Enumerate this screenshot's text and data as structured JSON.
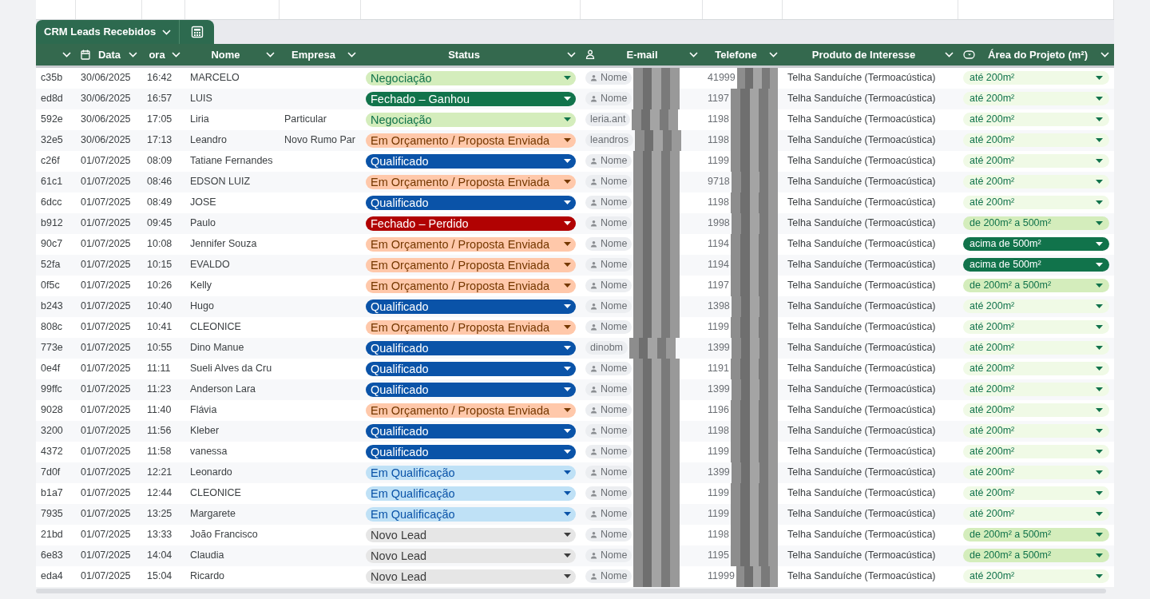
{
  "table_tab": {
    "label": "CRM Leads Recebidos"
  },
  "columns": [
    {},
    {
      "label": "Data"
    },
    {
      "label": "ora"
    },
    {
      "label": "Nome"
    },
    {
      "label": "Empresa"
    },
    {
      "label": "Status"
    },
    {
      "label": "E-mail"
    },
    {
      "label": "Telefone"
    },
    {
      "label": "Produto de Interesse"
    },
    {
      "label": "Área do Projeto (m²)"
    }
  ],
  "rows": [
    {
      "id": "c35b",
      "date": "30/06/2025",
      "time": "16:42",
      "name": "MARCELO",
      "company": "",
      "status": {
        "label": "Negociação",
        "kind": "negotiation"
      },
      "email": {
        "text": "Nome",
        "kind": "person"
      },
      "phone": "41999",
      "product": "Telha Sanduíche (Termoacústica)",
      "area": {
        "label": "até 200m²",
        "kind": "small"
      }
    },
    {
      "id": "ed8d",
      "date": "30/06/2025",
      "time": "16:57",
      "name": "LUIS",
      "company": "",
      "status": {
        "label": "Fechado – Ganhou",
        "kind": "won"
      },
      "email": {
        "text": "Nome",
        "kind": "person"
      },
      "phone": "1197",
      "product": "Telha Sanduíche (Termoacústica)",
      "area": {
        "label": "até 200m²",
        "kind": "small"
      }
    },
    {
      "id": "592e",
      "date": "30/06/2025",
      "time": "17:05",
      "name": "Liria",
      "company": "Particular",
      "status": {
        "label": "Negociação",
        "kind": "negotiation"
      },
      "email": {
        "text": "leria.ant",
        "kind": "address"
      },
      "phone": "1198",
      "product": "Telha Sanduíche (Termoacústica)",
      "area": {
        "label": "até 200m²",
        "kind": "small"
      }
    },
    {
      "id": "32e5",
      "date": "30/06/2025",
      "time": "17:13",
      "name": "Leandro",
      "company": "Novo Rumo Par",
      "status": {
        "label": "Em Orçamento / Proposta Enviada",
        "kind": "proposal"
      },
      "email": {
        "text": "leandros",
        "kind": "address"
      },
      "phone": "1198",
      "product": "Telha Sanduíche (Termoacústica)",
      "area": {
        "label": "até 200m²",
        "kind": "small"
      }
    },
    {
      "id": "c26f",
      "date": "01/07/2025",
      "time": "08:09",
      "name": "Tatiane Fernandes",
      "company": "",
      "status": {
        "label": "Qualificado",
        "kind": "qualified"
      },
      "email": {
        "text": "Nome",
        "kind": "person"
      },
      "phone": "1199",
      "product": "Telha Sanduíche (Termoacústica)",
      "area": {
        "label": "até 200m²",
        "kind": "small"
      }
    },
    {
      "id": "61c1",
      "date": "01/07/2025",
      "time": "08:46",
      "name": "EDSON LUIZ",
      "company": "",
      "status": {
        "label": "Em Orçamento / Proposta Enviada",
        "kind": "proposal"
      },
      "email": {
        "text": "Nome",
        "kind": "person"
      },
      "phone": "9718",
      "product": "Telha Sanduíche (Termoacústica)",
      "area": {
        "label": "até 200m²",
        "kind": "small"
      }
    },
    {
      "id": "6dcc",
      "date": "01/07/2025",
      "time": "08:49",
      "name": "JOSE",
      "company": "",
      "status": {
        "label": "Qualificado",
        "kind": "qualified"
      },
      "email": {
        "text": "Nome",
        "kind": "person"
      },
      "phone": "1198",
      "product": "Telha Sanduíche (Termoacústica)",
      "area": {
        "label": "até 200m²",
        "kind": "small"
      }
    },
    {
      "id": "b912",
      "date": "01/07/2025",
      "time": "09:45",
      "name": "Paulo",
      "company": "",
      "status": {
        "label": "Fechado – Perdido",
        "kind": "lost"
      },
      "email": {
        "text": "Nome",
        "kind": "person"
      },
      "phone": "1998",
      "product": "Telha Sanduíche (Termoacústica)",
      "area": {
        "label": "de 200m² a 500m²",
        "kind": "medium"
      }
    },
    {
      "id": "90c7",
      "date": "01/07/2025",
      "time": "10:08",
      "name": "Jennifer Souza",
      "company": "",
      "status": {
        "label": "Em Orçamento / Proposta Enviada",
        "kind": "proposal"
      },
      "email": {
        "text": "Nome",
        "kind": "person"
      },
      "phone": "1194",
      "product": "Telha Sanduíche (Termoacústica)",
      "area": {
        "label": "acima de 500m²",
        "kind": "large"
      }
    },
    {
      "id": "52fa",
      "date": "01/07/2025",
      "time": "10:15",
      "name": "EVALDO",
      "company": "",
      "status": {
        "label": "Em Orçamento / Proposta Enviada",
        "kind": "proposal"
      },
      "email": {
        "text": "Nome",
        "kind": "person"
      },
      "phone": "1194",
      "product": "Telha Sanduíche (Termoacústica)",
      "area": {
        "label": "acima de 500m²",
        "kind": "large"
      }
    },
    {
      "id": "0f5c",
      "date": "01/07/2025",
      "time": "10:26",
      "name": "Kelly",
      "company": "",
      "status": {
        "label": "Em Orçamento / Proposta Enviada",
        "kind": "proposal"
      },
      "email": {
        "text": "Nome",
        "kind": "person"
      },
      "phone": "1197",
      "product": "Telha Sanduíche (Termoacústica)",
      "area": {
        "label": "de 200m² a 500m²",
        "kind": "medium"
      }
    },
    {
      "id": "b243",
      "date": "01/07/2025",
      "time": "10:40",
      "name": "Hugo",
      "company": "",
      "status": {
        "label": "Qualificado",
        "kind": "qualified"
      },
      "email": {
        "text": "Nome",
        "kind": "person"
      },
      "phone": "1398",
      "product": "Telha Sanduíche (Termoacústica)",
      "area": {
        "label": "até 200m²",
        "kind": "small"
      }
    },
    {
      "id": "808c",
      "date": "01/07/2025",
      "time": "10:41",
      "name": "CLEONICE",
      "company": "",
      "status": {
        "label": "Em Orçamento / Proposta Enviada",
        "kind": "proposal"
      },
      "email": {
        "text": "Nome",
        "kind": "person"
      },
      "phone": "1199",
      "product": "Telha Sanduíche (Termoacústica)",
      "area": {
        "label": "até 200m²",
        "kind": "small"
      }
    },
    {
      "id": "773e",
      "date": "01/07/2025",
      "time": "10:55",
      "name": "Dino Manue",
      "company": "",
      "status": {
        "label": "Qualificado",
        "kind": "qualified"
      },
      "email": {
        "text": "dinobm",
        "kind": "address"
      },
      "phone": "1399",
      "product": "Telha Sanduíche (Termoacústica)",
      "area": {
        "label": "até 200m²",
        "kind": "small"
      }
    },
    {
      "id": "0e4f",
      "date": "01/07/2025",
      "time": "11:11",
      "name": "Sueli Alves da Cru",
      "company": "",
      "status": {
        "label": "Qualificado",
        "kind": "qualified"
      },
      "email": {
        "text": "Nome",
        "kind": "person"
      },
      "phone": "1191",
      "product": "Telha Sanduíche (Termoacústica)",
      "area": {
        "label": "até 200m²",
        "kind": "small"
      }
    },
    {
      "id": "99ffc",
      "date": "01/07/2025",
      "time": "11:23",
      "name": "Anderson Lara",
      "company": "",
      "status": {
        "label": "Qualificado",
        "kind": "qualified"
      },
      "email": {
        "text": "Nome",
        "kind": "person"
      },
      "phone": "1399",
      "product": "Telha Sanduíche (Termoacústica)",
      "area": {
        "label": "até 200m²",
        "kind": "small"
      }
    },
    {
      "id": "9028",
      "date": "01/07/2025",
      "time": "11:40",
      "name": "Flávia",
      "company": "",
      "status": {
        "label": "Em Orçamento / Proposta Enviada",
        "kind": "proposal"
      },
      "email": {
        "text": "Nome",
        "kind": "person"
      },
      "phone": "1196",
      "product": "Telha Sanduíche (Termoacústica)",
      "area": {
        "label": "até 200m²",
        "kind": "small"
      }
    },
    {
      "id": "3200",
      "date": "01/07/2025",
      "time": "11:56",
      "name": "Kleber",
      "company": "",
      "status": {
        "label": "Qualificado",
        "kind": "qualified"
      },
      "email": {
        "text": "Nome",
        "kind": "person"
      },
      "phone": "1198",
      "product": "Telha Sanduíche (Termoacústica)",
      "area": {
        "label": "até 200m²",
        "kind": "small"
      }
    },
    {
      "id": "4372",
      "date": "01/07/2025",
      "time": "11:58",
      "name": "vanessa",
      "company": "",
      "status": {
        "label": "Qualificado",
        "kind": "qualified"
      },
      "email": {
        "text": "Nome",
        "kind": "person"
      },
      "phone": "1199",
      "product": "Telha Sanduíche (Termoacústica)",
      "area": {
        "label": "até 200m²",
        "kind": "small"
      }
    },
    {
      "id": "7d0f",
      "date": "01/07/2025",
      "time": "12:21",
      "name": "Leonardo",
      "company": "",
      "status": {
        "label": "Em Qualificação",
        "kind": "qualifying"
      },
      "email": {
        "text": "Nome",
        "kind": "person"
      },
      "phone": "1399",
      "product": "Telha Sanduíche (Termoacústica)",
      "area": {
        "label": "até 200m²",
        "kind": "small"
      }
    },
    {
      "id": "b1a7",
      "date": "01/07/2025",
      "time": "12:44",
      "name": "CLEONICE",
      "company": "",
      "status": {
        "label": "Em Qualificação",
        "kind": "qualifying"
      },
      "email": {
        "text": "Nome",
        "kind": "person"
      },
      "phone": "1199",
      "product": "Telha Sanduíche (Termoacústica)",
      "area": {
        "label": "até 200m²",
        "kind": "small"
      }
    },
    {
      "id": "7935",
      "date": "01/07/2025",
      "time": "13:25",
      "name": "Margarete",
      "company": "",
      "status": {
        "label": "Em Qualificação",
        "kind": "qualifying"
      },
      "email": {
        "text": "Nome",
        "kind": "person"
      },
      "phone": "1199",
      "product": "Telha Sanduíche (Termoacústica)",
      "area": {
        "label": "até 200m²",
        "kind": "small"
      }
    },
    {
      "id": "21bd",
      "date": "01/07/2025",
      "time": "13:33",
      "name": "João Francisco",
      "company": "",
      "status": {
        "label": "Novo Lead",
        "kind": "new"
      },
      "email": {
        "text": "Nome",
        "kind": "person"
      },
      "phone": "1198",
      "product": "Telha Sanduíche (Termoacústica)",
      "area": {
        "label": "de 200m² a 500m²",
        "kind": "medium"
      }
    },
    {
      "id": "6e83",
      "date": "01/07/2025",
      "time": "14:04",
      "name": "Claudia",
      "company": "",
      "status": {
        "label": "Novo Lead",
        "kind": "new"
      },
      "email": {
        "text": "Nome",
        "kind": "person"
      },
      "phone": "1195",
      "product": "Telha Sanduíche (Termoacústica)",
      "area": {
        "label": "de 200m² a 500m²",
        "kind": "medium"
      }
    },
    {
      "id": "eda4",
      "date": "01/07/2025",
      "time": "15:04",
      "name": "Ricardo",
      "company": "",
      "status": {
        "label": "Novo Lead",
        "kind": "new"
      },
      "email": {
        "text": "Nome",
        "kind": "person"
      },
      "phone": "11999",
      "product": "Telha Sanduíche (Termoacústica)",
      "area": {
        "label": "até 200m²",
        "kind": "small"
      }
    }
  ]
}
